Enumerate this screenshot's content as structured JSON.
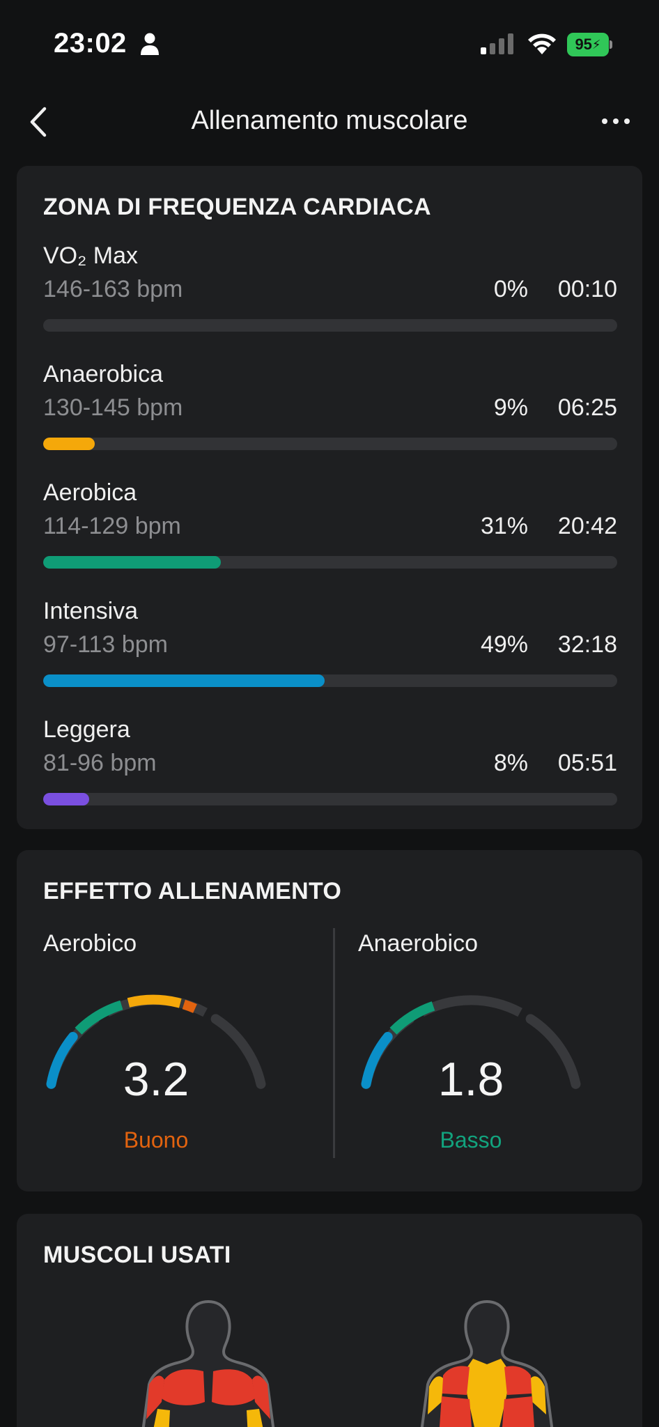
{
  "status_bar": {
    "time": "23:02",
    "battery": "95"
  },
  "nav": {
    "title": "Allenamento muscolare"
  },
  "heart_zones": {
    "title": "ZONA DI FREQUENZA CARDIACA",
    "zones": [
      {
        "name": "VO₂ Max",
        "range": "146-163 bpm",
        "percent": "0%",
        "time": "00:10",
        "fill_fraction": 0.0,
        "color": "#6f7073"
      },
      {
        "name": "Anaerobica",
        "range": "130-145 bpm",
        "percent": "9%",
        "time": "06:25",
        "fill_fraction": 0.09,
        "color": "#f5a80a"
      },
      {
        "name": "Aerobica",
        "range": "114-129 bpm",
        "percent": "31%",
        "time": "20:42",
        "fill_fraction": 0.31,
        "color": "#0f9c76"
      },
      {
        "name": "Intensiva",
        "range": "97-113 bpm",
        "percent": "49%",
        "time": "32:18",
        "fill_fraction": 0.49,
        "color": "#0a8fc8"
      },
      {
        "name": "Leggera",
        "range": "81-96 bpm",
        "percent": "8%",
        "time": "05:51",
        "fill_fraction": 0.08,
        "color": "#7a4fe0"
      }
    ]
  },
  "training_effect": {
    "title": "EFFETTO ALLENAMENTO",
    "aerobic": {
      "label": "Aerobico",
      "value": "3.2",
      "status": "Buono",
      "status_color": "#e2630f"
    },
    "anaerobic": {
      "label": "Anaerobico",
      "value": "1.8",
      "status": "Basso",
      "status_color": "#12a37e"
    }
  },
  "muscles": {
    "title": "MUSCOLI USATI"
  },
  "colors": {
    "gauge_blue": "#0a8fc8",
    "gauge_green": "#0f9c76",
    "gauge_yellow": "#f5a80a",
    "gauge_orange": "#e2630f",
    "gauge_track": "#38393c"
  }
}
